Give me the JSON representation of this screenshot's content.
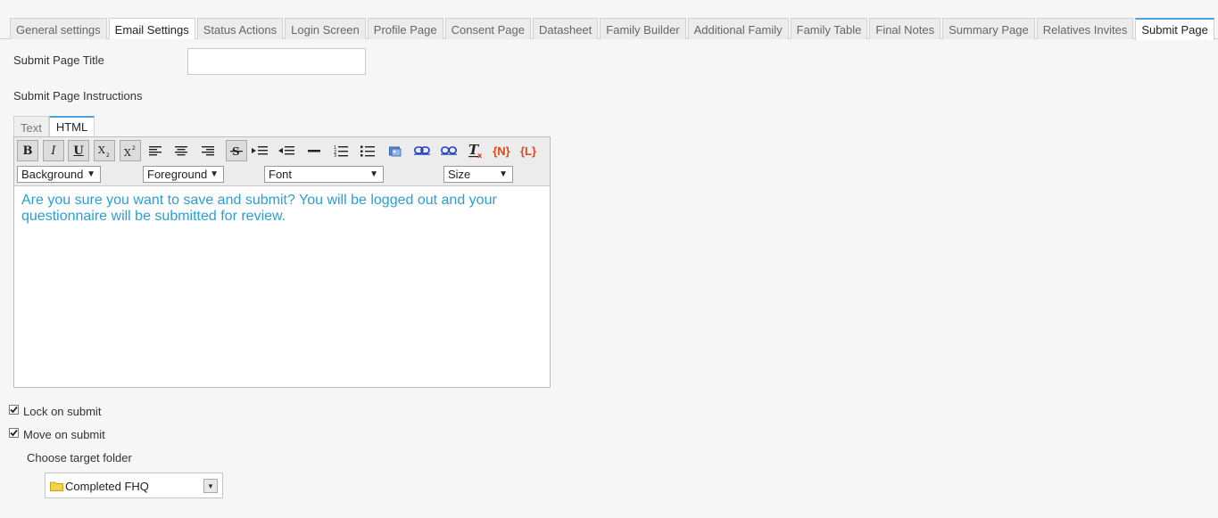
{
  "tabs": [
    "General settings",
    "Email Settings",
    "Status Actions",
    "Login Screen",
    "Profile Page",
    "Consent Page",
    "Datasheet",
    "Family Builder",
    "Additional Family",
    "Family Table",
    "Final Notes",
    "Summary Page",
    "Relatives Invites",
    "Submit Page"
  ],
  "active_tab": "Submit Page",
  "form": {
    "title_label": "Submit Page Title",
    "title_value": "",
    "instructions_label": "Submit Page Instructions"
  },
  "editor": {
    "mode_tabs": [
      "Text",
      "HTML"
    ],
    "active_mode": "HTML",
    "toolbar": {
      "bold": "B",
      "italic": "I",
      "underline": "U",
      "merge_n": "{N}",
      "merge_l": "{L}"
    },
    "dropdowns": {
      "background": "Background",
      "foreground": "Foreground",
      "font": "Font",
      "size": "Size"
    },
    "content": "Are you sure you want to save and submit? You will be logged out and your questionnaire will be submitted for review.",
    "content_color": "#2a9fd6"
  },
  "options": {
    "lock_on_submit": {
      "label": "Lock on submit",
      "checked": true
    },
    "move_on_submit": {
      "label": "Move on submit",
      "checked": true
    },
    "target_folder_label": "Choose target folder",
    "target_folder_value": "Completed FHQ"
  }
}
